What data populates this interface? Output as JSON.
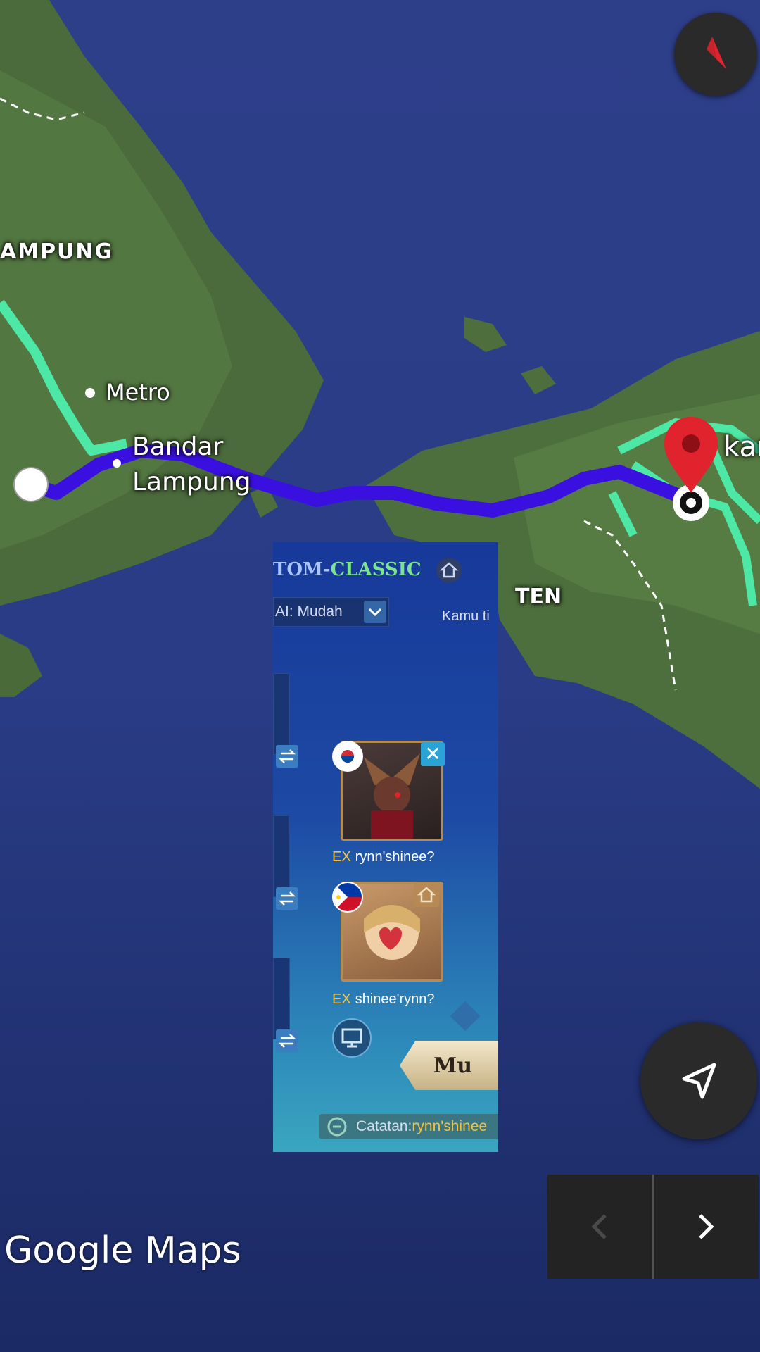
{
  "map": {
    "labels": {
      "lampung": "AMPUNG",
      "metro": "Metro",
      "bandar_lampung": "Bandar\nLampung",
      "banten": "TEN",
      "jakarta": "kar"
    },
    "colors": {
      "route": "#3a10e0",
      "alt_route": "#4de8a6",
      "pin": "#e0232c"
    }
  },
  "controls": {
    "compass_icon": "compass-icon",
    "recenter_icon": "navigation-arrow-icon",
    "prev_icon": "chevron-left-icon",
    "next_icon": "chevron-right-icon"
  },
  "watermark": "Google Maps",
  "game": {
    "title_a": "TOM-",
    "title_b": "CLASSIC",
    "ai_select": "AI: Mudah",
    "kamu": "Kamu ti",
    "players": [
      {
        "ex": "EX",
        "name": "rynn'shinee?",
        "flag": "south-korea"
      },
      {
        "ex": "EX",
        "name": "shinee'rynn?",
        "flag": "philippines"
      }
    ],
    "start_button": "Mu",
    "note_label": "Catatan:",
    "note_value": "rynn'shinee"
  }
}
